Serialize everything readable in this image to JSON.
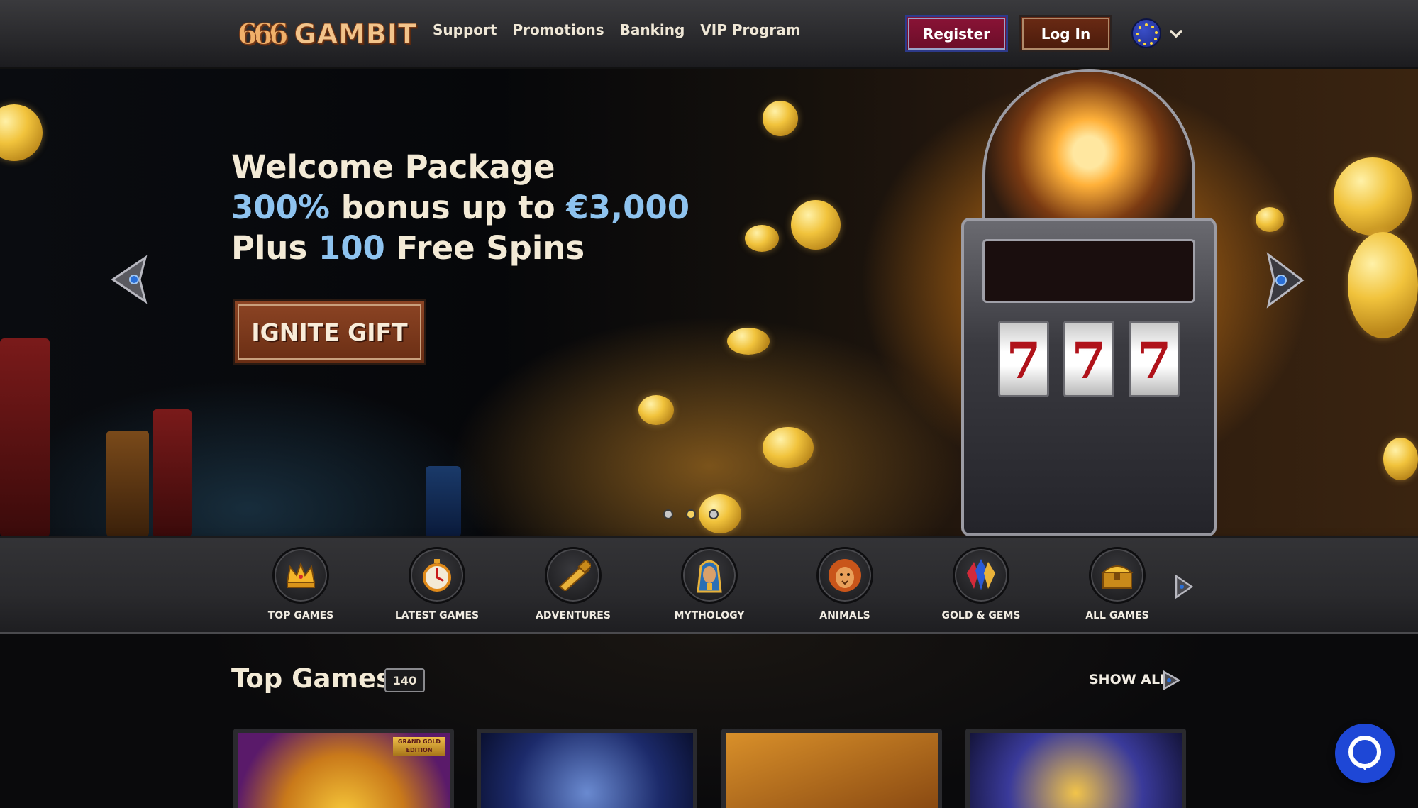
{
  "brand": {
    "logo_mark": "666",
    "logo_word": "GAMBIT"
  },
  "nav": {
    "items": [
      "Support",
      "Promotions",
      "Banking",
      "VIP Program"
    ]
  },
  "auth": {
    "register_label": "Register",
    "login_label": "Log In"
  },
  "language": {
    "icon": "eu-flag-icon"
  },
  "hero": {
    "line1": "Welcome Package",
    "line2_highlight_1": "300%",
    "line2_text": " bonus up to ",
    "line2_highlight_2": "€3,000",
    "line3_text_1": "Plus ",
    "line3_highlight": "100",
    "line3_text_2": " Free Spins",
    "cta_label": "IGNITE GIFT",
    "slide_count": 3,
    "active_slide": 2,
    "reels": [
      "7",
      "7",
      "7"
    ]
  },
  "categories": {
    "items": [
      {
        "label": "TOP GAMES",
        "icon": "crown-icon"
      },
      {
        "label": "LATEST GAMES",
        "icon": "stopwatch-icon"
      },
      {
        "label": "ADVENTURES",
        "icon": "spyglass-icon"
      },
      {
        "label": "MYTHOLOGY",
        "icon": "pharaoh-icon"
      },
      {
        "label": "ANIMALS",
        "icon": "lion-icon"
      },
      {
        "label": "GOLD & GEMS",
        "icon": "gems-icon"
      },
      {
        "label": "ALL GAMES",
        "icon": "treasure-chest-icon"
      }
    ]
  },
  "top_games": {
    "title": "Top Games",
    "count": "140",
    "show_all_label": "SHOW ALL",
    "first_card_badge": "GRAND GOLD EDITION"
  },
  "colors": {
    "accent_blue": "#8ec3ef",
    "register_bg": "#8a1336",
    "login_bg": "#6a2a14",
    "chat_blue": "#1e47d6"
  }
}
